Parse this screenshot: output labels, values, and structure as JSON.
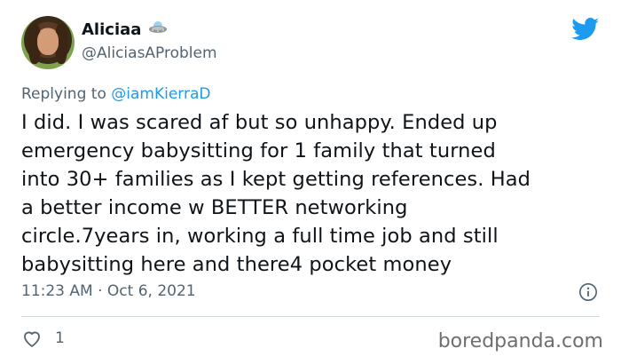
{
  "user": {
    "name": "Aliciaa",
    "handle": "@AliciasAProblem"
  },
  "reply": {
    "prefix": "Replying to",
    "to": "@iamKierraD"
  },
  "tweet": {
    "lines": [
      "I did.  I was scared af but so unhappy. Ended up",
      "emergency babysitting for 1 family that turned",
      "into 30+ families as I kept getting references. Had",
      "a better income w BETTER networking",
      "circle.7years in, working a full time job and still",
      "babysitting here and there4 pocket money"
    ],
    "time": "11:23 AM",
    "separator": "·",
    "date": "Oct 6, 2021",
    "likes": "1"
  },
  "watermark": "boredpanda.com",
  "icons": {
    "badge": "ufo-emoji-icon",
    "brand": "twitter-bird-icon",
    "info": "info-icon",
    "like": "heart-icon"
  },
  "colors": {
    "brand": "#1d9bf0",
    "secondary_text": "#536471",
    "text": "#0f1419",
    "divider": "#cfd9de"
  }
}
